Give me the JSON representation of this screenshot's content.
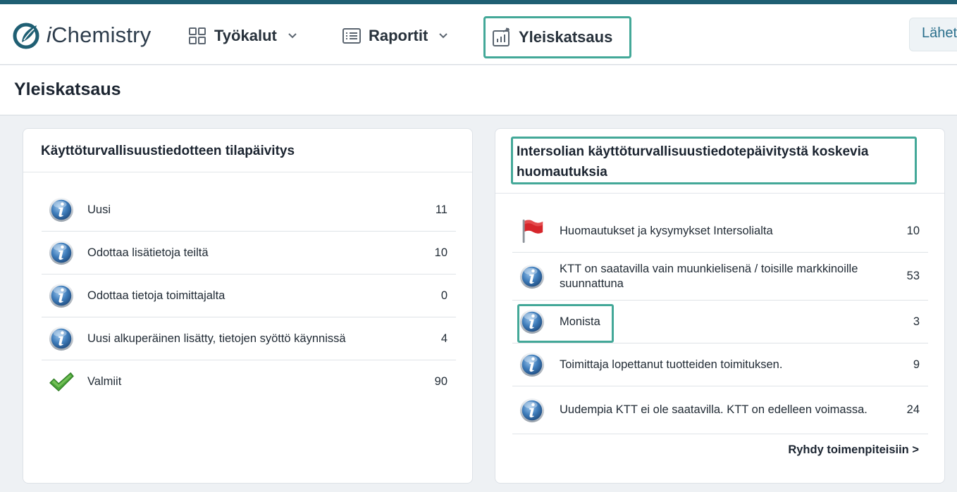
{
  "app": {
    "brand_prefix": "i",
    "brand_rest": "Chemistry"
  },
  "nav": {
    "tools_label": "Työkalut",
    "reports_label": "Raportit",
    "overview_label": "Yleiskatsaus",
    "send_label": "Lähetä"
  },
  "page": {
    "title": "Yleiskatsaus"
  },
  "status_card": {
    "title": "Käyttöturvallisuustiedotteen tilapäivitys",
    "rows": [
      {
        "label": "Uusi",
        "count": "11",
        "icon": "info-icon"
      },
      {
        "label": "Odottaa lisätietoja teiltä",
        "count": "10",
        "icon": "info-icon"
      },
      {
        "label": "Odottaa tietoja toimittajalta",
        "count": "0",
        "icon": "info-icon"
      },
      {
        "label": "Uusi alkuperäinen lisätty, tietojen syöttö käynnissä",
        "count": "4",
        "icon": "info-icon"
      },
      {
        "label": "Valmiit",
        "count": "90",
        "icon": "checkmark-icon"
      }
    ]
  },
  "notes_card": {
    "title": "Intersolian käyttöturvallisuustiedotepäivitystä koskevia huomautuksia",
    "rows": [
      {
        "label": "Huomautukset ja kysymykset Intersolialta",
        "count": "10",
        "icon": "red-flag-icon"
      },
      {
        "label": "KTT on saatavilla vain muunkielisenä / toisille markkinoille suunnattuna",
        "count": "53",
        "icon": "info-icon"
      },
      {
        "label": "Monista",
        "count": "3",
        "icon": "info-icon"
      },
      {
        "label": "Toimittaja lopettanut tuotteiden toimituksen.",
        "count": "9",
        "icon": "info-icon"
      },
      {
        "label": "Uudempia KTT ei ole saatavilla. KTT on edelleen voimassa.",
        "count": "24",
        "icon": "info-icon"
      }
    ],
    "action_label": "Ryhdy toimenpiteisiin >"
  },
  "colors": {
    "accent": "#1f5f73",
    "highlight": "#43a898",
    "link": "#2a6f8c"
  }
}
